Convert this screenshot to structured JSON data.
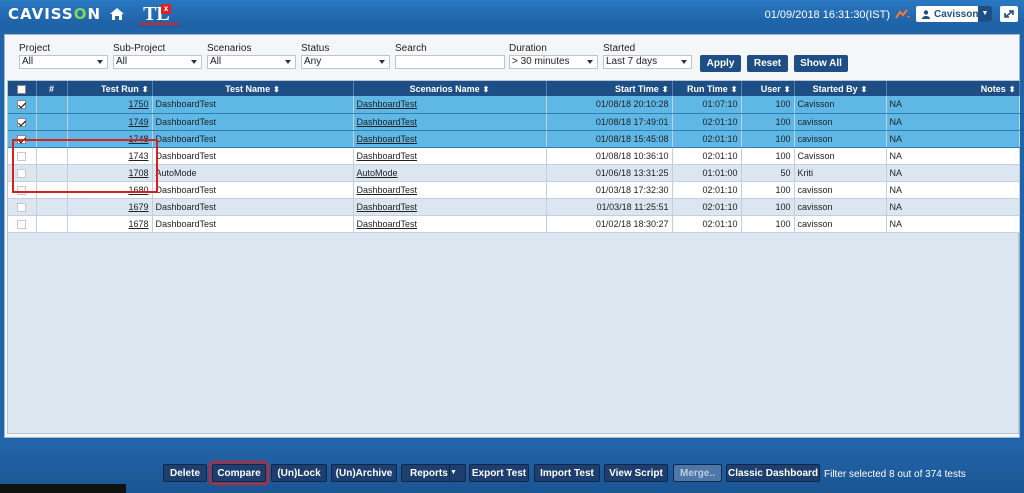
{
  "header": {
    "logo_prefix": "CAVISS",
    "logo_o": "O",
    "logo_suffix": "N",
    "tl_letter": "TL",
    "close_mark": "x",
    "datetime": "01/09/2018 16:31:30(IST)",
    "user": "Cavisson"
  },
  "filters": {
    "project": {
      "label": "Project",
      "value": "All"
    },
    "subproject": {
      "label": "Sub-Project",
      "value": "All"
    },
    "scenarios": {
      "label": "Scenarios",
      "value": "All"
    },
    "status": {
      "label": "Status",
      "value": "Any"
    },
    "search": {
      "label": "Search",
      "value": ""
    },
    "duration": {
      "label": "Duration",
      "value": "> 30 minutes"
    },
    "started": {
      "label": "Started",
      "value": "Last 7 days"
    },
    "apply": "Apply",
    "reset": "Reset",
    "show_all": "Show All"
  },
  "table": {
    "columns": [
      "#",
      "Test Run",
      "Test Name",
      "Scenarios Name",
      "Start Time",
      "Run Time",
      "User",
      "Started By",
      "Notes"
    ],
    "rows": [
      {
        "run": "1750",
        "name": "DashboardTest",
        "scenario": "DashboardTest",
        "start": "01/08/18 20:10:28",
        "runtime": "01:07:10",
        "user": "100",
        "by": "Cavisson",
        "notes": "NA",
        "checked": true
      },
      {
        "run": "1749",
        "name": "DashboardTest",
        "scenario": "DashboardTest",
        "start": "01/08/18 17:49:01",
        "runtime": "02:01:10",
        "user": "100",
        "by": "cavisson",
        "notes": "NA",
        "checked": true
      },
      {
        "run": "1748",
        "name": "DashboardTest",
        "scenario": "DashboardTest",
        "start": "01/08/18 15:45:08",
        "runtime": "02:01:10",
        "user": "100",
        "by": "cavisson",
        "notes": "NA",
        "checked": true
      },
      {
        "run": "1743",
        "name": "DashboardTest",
        "scenario": "DashboardTest",
        "start": "01/08/18 10:36:10",
        "runtime": "02:01:10",
        "user": "100",
        "by": "Cavisson",
        "notes": "NA",
        "checked": false
      },
      {
        "run": "1708",
        "name": "AutoMode",
        "scenario": "AutoMode",
        "start": "01/06/18 13:31:25",
        "runtime": "01:01:00",
        "user": "50",
        "by": "Kriti",
        "notes": "NA",
        "checked": false
      },
      {
        "run": "1680",
        "name": "DashboardTest",
        "scenario": "DashboardTest",
        "start": "01/03/18 17:32:30",
        "runtime": "02:01:10",
        "user": "100",
        "by": "cavisson",
        "notes": "NA",
        "checked": false
      },
      {
        "run": "1679",
        "name": "DashboardTest",
        "scenario": "DashboardTest",
        "start": "01/03/18 11:25:51",
        "runtime": "02:01:10",
        "user": "100",
        "by": "cavisson",
        "notes": "NA",
        "checked": false
      },
      {
        "run": "1678",
        "name": "DashboardTest",
        "scenario": "DashboardTest",
        "start": "01/02/18 18:30:27",
        "runtime": "02:01:10",
        "user": "100",
        "by": "cavisson",
        "notes": "NA",
        "checked": false
      }
    ]
  },
  "footer": {
    "delete": "Delete",
    "compare": "Compare",
    "unlock": "(Un)Lock",
    "unarchive": "(Un)Archive",
    "reports": "Reports",
    "export": "Export Test",
    "import": "Import Test",
    "view_script": "View Script",
    "merge": "Merge..",
    "classic": "Classic Dashboard",
    "filter_status": "Filter selected 8 out of 374 tests"
  },
  "colors": {
    "header": "#1d5fa3",
    "selected_row": "#5fb7e6",
    "button": "#1d3e6e",
    "highlight": "#d82020"
  }
}
